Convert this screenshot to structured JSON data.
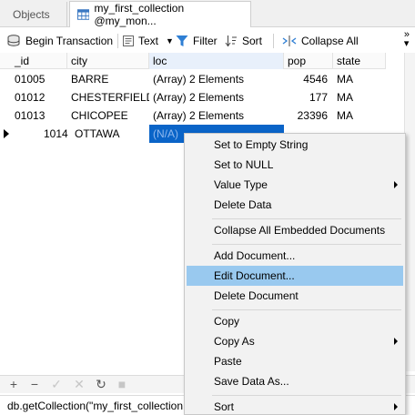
{
  "tabs": {
    "objects": "Objects",
    "active": "my_first_collection @my_mon..."
  },
  "toolbar": {
    "begin_transaction": "Begin Transaction",
    "text": "Text",
    "filter": "Filter",
    "sort": "Sort",
    "collapse_all": "Collapse All"
  },
  "grid": {
    "columns": [
      "_id",
      "city",
      "loc",
      "pop",
      "state"
    ],
    "rows": [
      {
        "id": "01005",
        "city": "BARRE",
        "loc": "(Array) 2 Elements",
        "pop": "4546",
        "state": "MA"
      },
      {
        "id": "01012",
        "city": "CHESTERFIELD",
        "loc": "(Array) 2 Elements",
        "pop": "177",
        "state": "MA"
      },
      {
        "id": "01013",
        "city": "CHICOPEE",
        "loc": "(Array) 2 Elements",
        "pop": "23396",
        "state": "MA"
      },
      {
        "id": "1014",
        "city": "OTTAWA",
        "loc": "(N/A)",
        "pop": "",
        "state": ""
      }
    ]
  },
  "bottom": {
    "query": "db.getCollection(\"my_first_collection"
  },
  "menu": {
    "set_empty": "Set to Empty String",
    "set_null": "Set to NULL",
    "value_type": "Value Type",
    "delete_data": "Delete Data",
    "collapse_embedded": "Collapse All Embedded Documents",
    "add_document": "Add Document...",
    "edit_document": "Edit Document...",
    "delete_document": "Delete Document",
    "copy": "Copy",
    "copy_as": "Copy As",
    "paste": "Paste",
    "save_data_as": "Save Data As...",
    "sort": "Sort"
  },
  "colors": {
    "selection": "#0a64c8",
    "menu_highlight": "#99c9ef",
    "filter_icon": "#2f7fd4"
  }
}
